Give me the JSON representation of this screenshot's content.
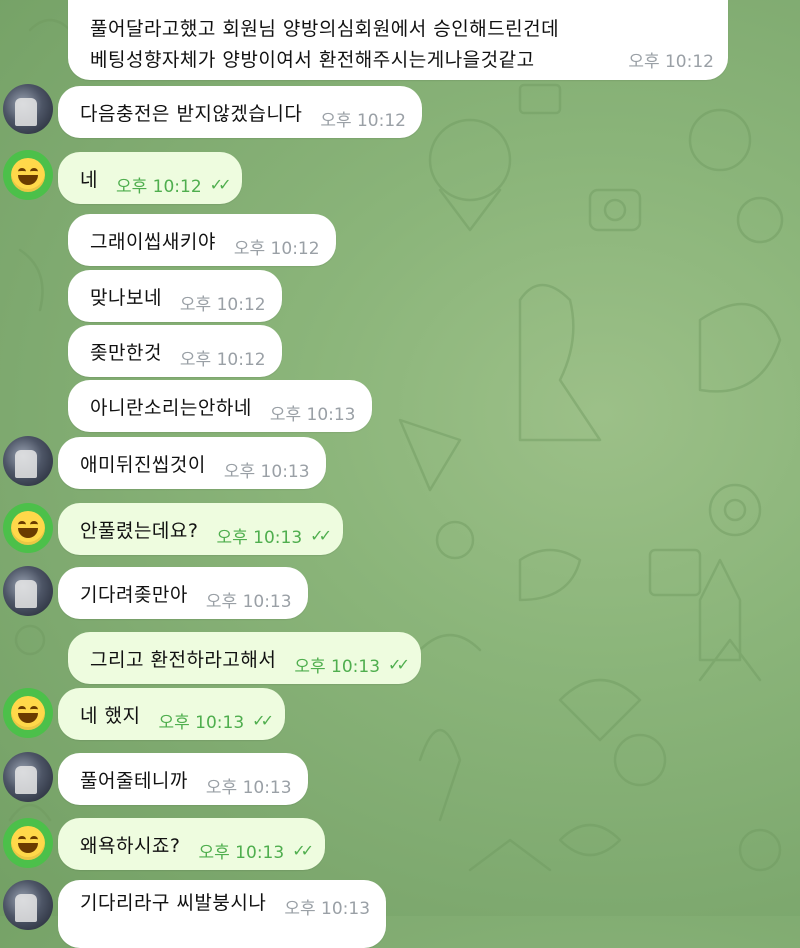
{
  "messages": [
    {
      "lines": [
        "풀어달라고했고 회원님 양방의심회원에서 승인해드린건데",
        "베팅성향자체가 양방이여서 환전해주시는게나을것같고"
      ],
      "time": "오후 10:12",
      "outgoing": false
    },
    {
      "text": "다음충전은 받지않겠습니다",
      "time": "오후 10:12",
      "outgoing": false
    },
    {
      "text": "네",
      "time": "오후 10:12",
      "outgoing": true
    },
    {
      "text": "그래이씹새키야",
      "time": "오후 10:12",
      "outgoing": false
    },
    {
      "text": "맞나보네",
      "time": "오후 10:12",
      "outgoing": false
    },
    {
      "text": "좆만한것",
      "time": "오후 10:12",
      "outgoing": false
    },
    {
      "text": "아니란소리는안하네",
      "time": "오후 10:13",
      "outgoing": false
    },
    {
      "text": "애미뒤진씹것이",
      "time": "오후 10:13",
      "outgoing": false
    },
    {
      "text": "안풀렸는데요?",
      "time": "오후 10:13",
      "outgoing": true
    },
    {
      "text": "기다려좆만아",
      "time": "오후 10:13",
      "outgoing": false
    },
    {
      "text": "그리고 환전하라고해서",
      "time": "오후 10:13",
      "outgoing": true
    },
    {
      "text": "네 했지",
      "time": "오후 10:13",
      "outgoing": true
    },
    {
      "text": "풀어줄테니까",
      "time": "오후 10:13",
      "outgoing": false
    },
    {
      "text": "왜욕하시죠?",
      "time": "오후 10:13",
      "outgoing": true
    },
    {
      "text": "기다리라구 씨발붕시나",
      "time": "오후 10:13",
      "outgoing": false
    }
  ],
  "read_receipt_icon": "double-check-icon",
  "avatars": {
    "contact": "contact-avatar",
    "self": "laughing-emoji-avatar"
  },
  "colors": {
    "incoming_bubble": "#ffffff",
    "outgoing_bubble": "#eefcdf",
    "time_in": "#9aa0a6",
    "time_out": "#4fae4e",
    "wallpaper": "#8bb57a"
  }
}
